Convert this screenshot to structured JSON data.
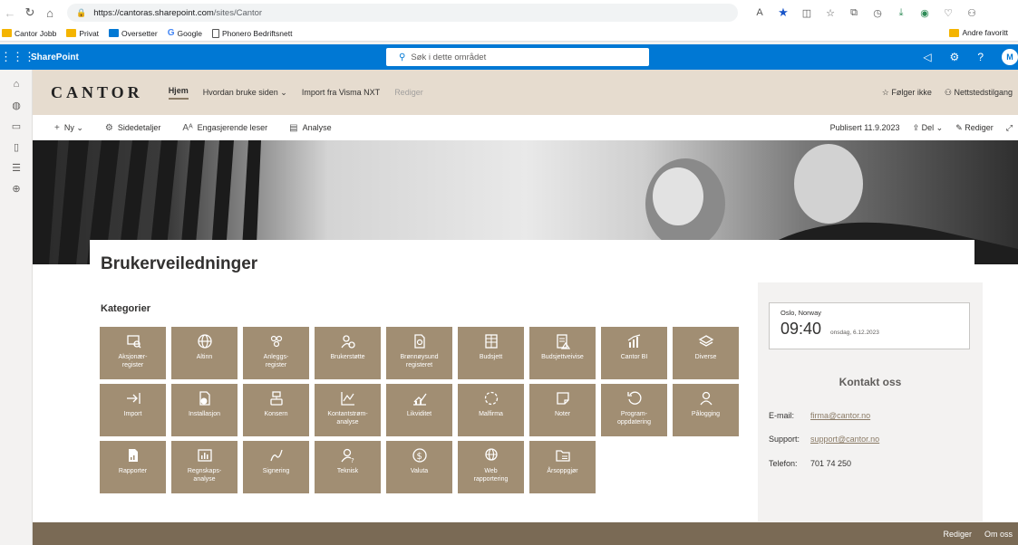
{
  "browser": {
    "url_host": "https://cantoras.sharepoint.com",
    "url_path": "/sites/Cantor",
    "favorites": [
      {
        "label": "Cantor Jobb",
        "icon": "folder-icon"
      },
      {
        "label": "Privat",
        "icon": "folder-icon"
      },
      {
        "label": "Oversetter",
        "icon": "translator-icon"
      },
      {
        "label": "Google",
        "icon": "google-icon"
      },
      {
        "label": "Phonero Bedriftsnett",
        "icon": "page-icon"
      }
    ],
    "other_favorites": "Andre favoritt"
  },
  "suite": {
    "app_name": "SharePoint",
    "search_placeholder": "Søk i dette området",
    "avatar_initial": "M"
  },
  "site": {
    "logo": "CANTOR",
    "nav": [
      "Hjem",
      "Hvordan bruke siden",
      "Import fra Visma NXT",
      "Rediger"
    ],
    "follow": "Følger ikke",
    "access": "Nettstedstilgang"
  },
  "commandbar": {
    "new": "Ny",
    "details": "Sidedetaljer",
    "reader": "Engasjerende leser",
    "analytics": "Analyse",
    "published": "Publisert 11.9.2023",
    "share": "Del",
    "edit": "Rediger"
  },
  "page": {
    "title": "Brukerveiledninger",
    "categories_heading": "Kategorier"
  },
  "tiles": [
    {
      "label": "Aksjonær-\nregister",
      "icon": "person-search-icon"
    },
    {
      "label": "Altinn",
      "icon": "globe-icon"
    },
    {
      "label": "Anleggs-\nregister",
      "icon": "people-icon"
    },
    {
      "label": "Brukerstøtte",
      "icon": "person-settings-icon"
    },
    {
      "label": "Brønnøysund\nregisteret",
      "icon": "document-search-icon"
    },
    {
      "label": "Budsjett",
      "icon": "spreadsheet-icon"
    },
    {
      "label": "Budsjettveivise",
      "icon": "document-warning-icon"
    },
    {
      "label": "Cantor BI",
      "icon": "chart-icon"
    },
    {
      "label": "Diverse",
      "icon": "layers-icon"
    },
    {
      "label": "Import",
      "icon": "import-arrow-icon"
    },
    {
      "label": "Installasjon",
      "icon": "install-icon"
    },
    {
      "label": "Konsern",
      "icon": "organization-icon"
    },
    {
      "label": "Kontantstrøm-\nanalyse",
      "icon": "line-chart-search-icon"
    },
    {
      "label": "Likviditet",
      "icon": "trend-icon"
    },
    {
      "label": "Malfirma",
      "icon": "refresh-dashed-icon"
    },
    {
      "label": "Noter",
      "icon": "note-icon"
    },
    {
      "label": "Program-\noppdatering",
      "icon": "update-icon"
    },
    {
      "label": "Pålogging",
      "icon": "login-person-icon"
    },
    {
      "label": "Rapporter",
      "icon": "report-icon"
    },
    {
      "label": "Regnskaps-\nanalyse",
      "icon": "analysis-icon"
    },
    {
      "label": "Signering",
      "icon": "signature-icon"
    },
    {
      "label": "Teknisk",
      "icon": "person-question-icon"
    },
    {
      "label": "Valuta",
      "icon": "currency-icon"
    },
    {
      "label": "Web\nrapportering",
      "icon": "web-icon"
    },
    {
      "label": "Årsoppgjør",
      "icon": "folder-list-icon"
    }
  ],
  "clock": {
    "city": "Oslo, Norway",
    "time": "09:40",
    "date": "onsdag, 6.12.2023"
  },
  "contact": {
    "title": "Kontakt oss",
    "email_label": "E-mail:",
    "email": "firma@cantor.no",
    "support_label": "Support:",
    "support": "support@cantor.no",
    "phone_label": "Telefon:",
    "phone": "701 74 250"
  },
  "footer": {
    "edit": "Rediger",
    "about": "Om oss"
  },
  "colors": {
    "suite_blue": "#0078d4",
    "header_beige": "#e6dccf",
    "tile_brown": "#a18e73",
    "footer_brown": "#7a6a55"
  }
}
